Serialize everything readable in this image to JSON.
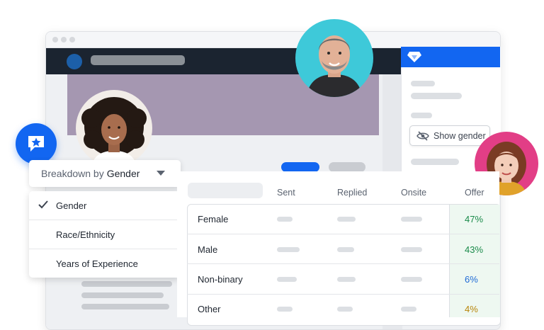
{
  "breakdown": {
    "prefix": "Breakdown by",
    "selected": "Gender"
  },
  "menu": {
    "items": [
      "Gender",
      "Race/Ethnicity",
      "Years of Experience"
    ],
    "checked_index": 0
  },
  "panel": {
    "toggle_label": "Show gender"
  },
  "table": {
    "headers": [
      "Sent",
      "Replied",
      "Onsite",
      "Offer"
    ],
    "rows": [
      {
        "label": "Female",
        "offer": "47%",
        "offer_color": "#1a8a4a"
      },
      {
        "label": "Male",
        "offer": "43%",
        "offer_color": "#1a8a4a"
      },
      {
        "label": "Non-binary",
        "offer": "6%",
        "offer_color": "#1f6bd6"
      },
      {
        "label": "Other",
        "offer": "4%",
        "offer_color": "#b8860b"
      }
    ]
  },
  "colors": {
    "accent": "#1266f1",
    "app_bar": "#1b2430",
    "offer_bg": "#eef8f1"
  }
}
